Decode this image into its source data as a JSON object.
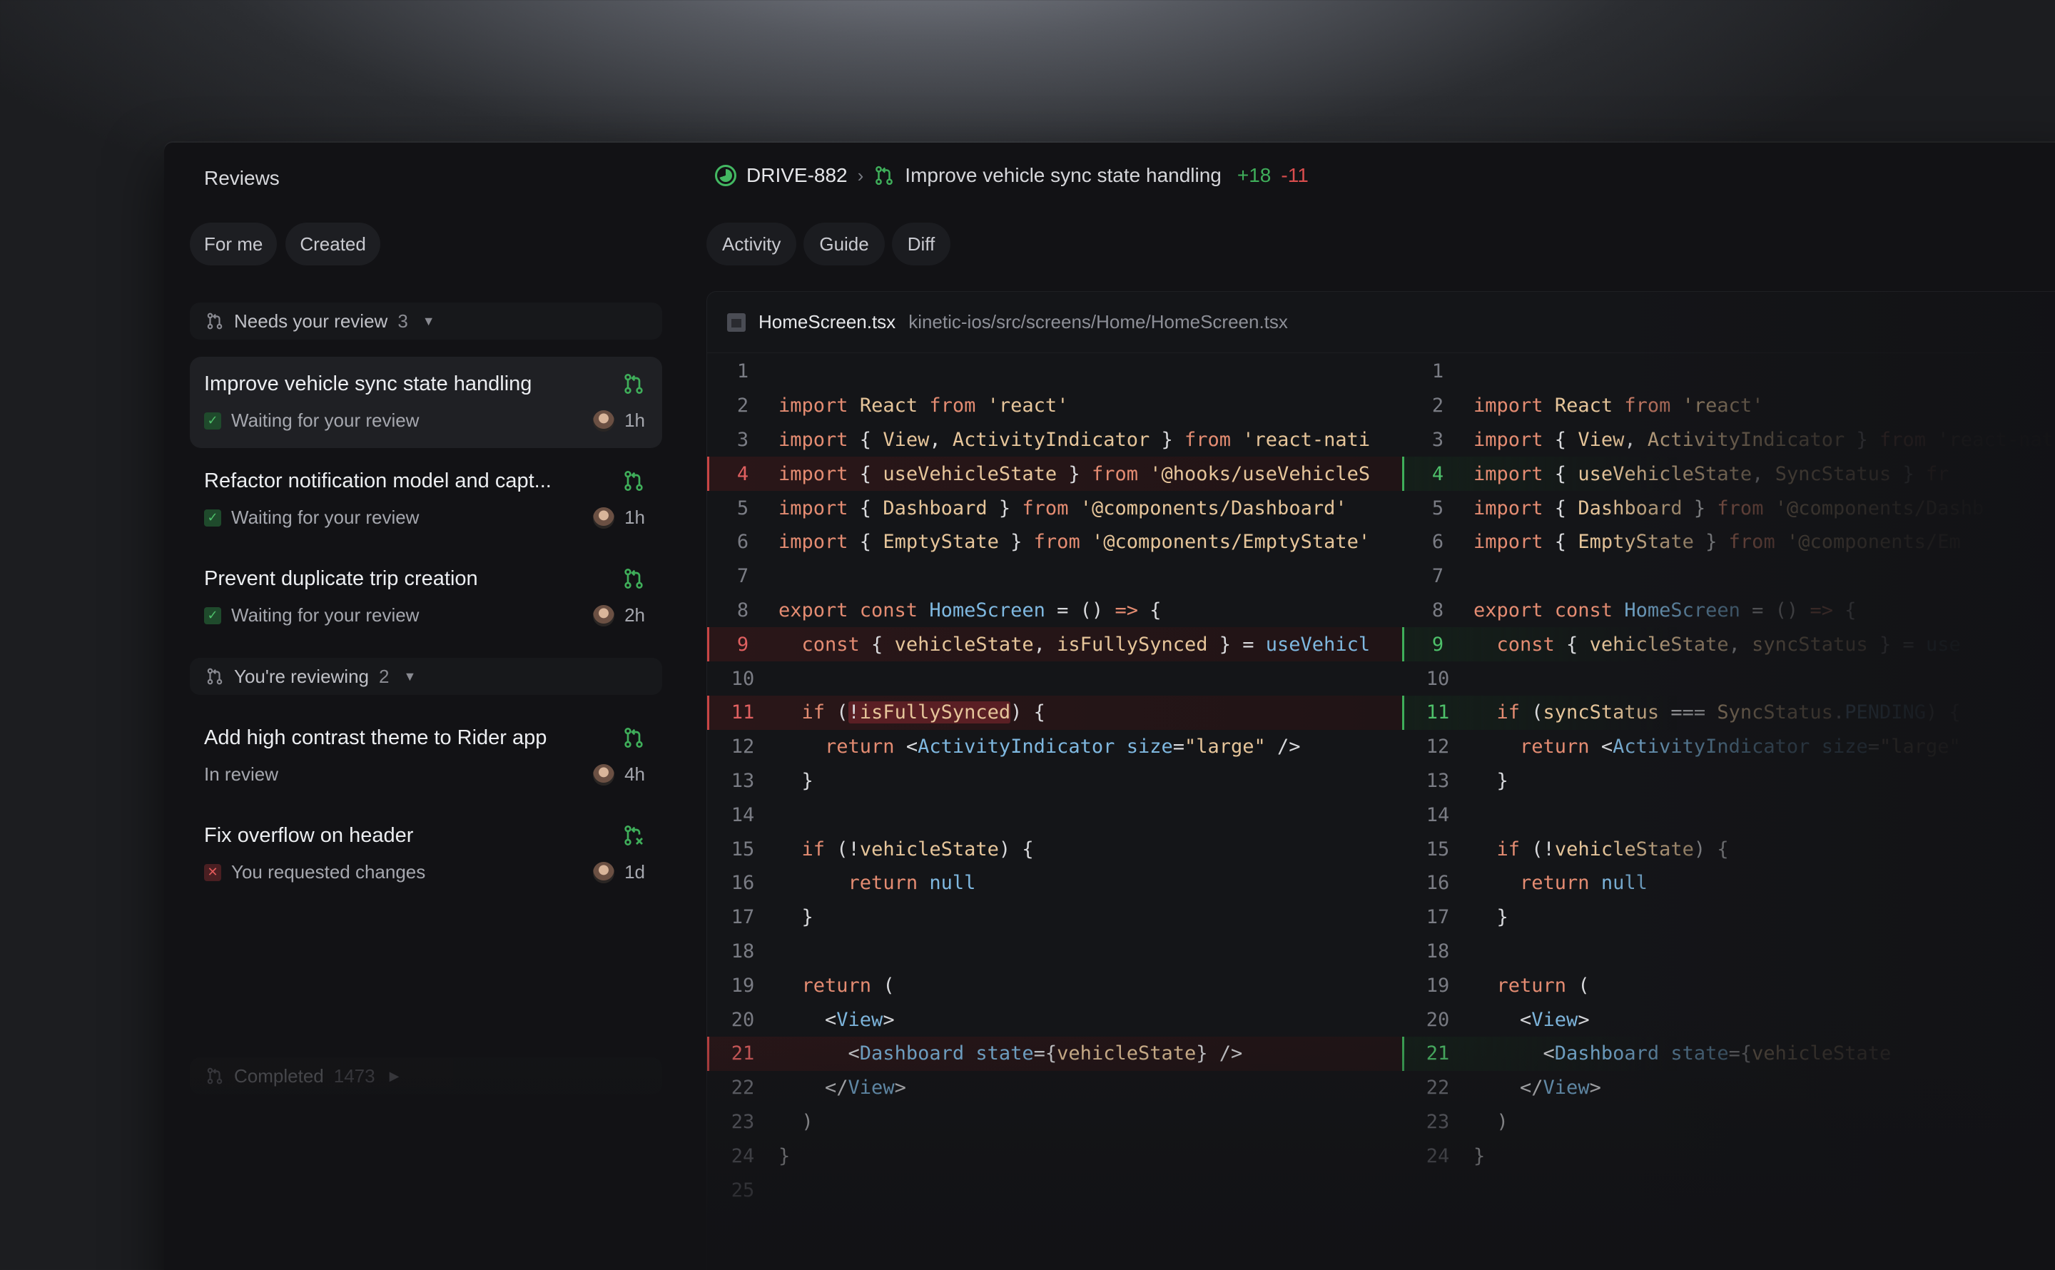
{
  "sidebar": {
    "title": "Reviews",
    "filters": [
      "For me",
      "Created"
    ],
    "groups": [
      {
        "label": "Needs your review",
        "count": "3"
      },
      {
        "label": "You're reviewing",
        "count": "2"
      },
      {
        "label": "Completed",
        "count": "1473"
      }
    ],
    "items": [
      {
        "title": "Improve vehicle sync state handling",
        "status": "Waiting for your review",
        "age": "1h"
      },
      {
        "title": "Refactor notification model and capt...",
        "status": "Waiting for your review",
        "age": "1h"
      },
      {
        "title": "Prevent duplicate trip creation",
        "status": "Waiting for your review",
        "age": "2h"
      },
      {
        "title": "Add high contrast theme to Rider app",
        "status": "In review",
        "age": "4h"
      },
      {
        "title": "Fix overflow on header",
        "status": "You requested changes",
        "age": "1d"
      }
    ]
  },
  "header": {
    "ticket": "DRIVE-882",
    "title": "Improve vehicle sync state handling",
    "additions": "+18",
    "deletions": "-11"
  },
  "tabs": [
    "Activity",
    "Guide",
    "Diff"
  ],
  "file": {
    "name": "HomeScreen.tsx",
    "path": "kinetic-ios/src/screens/Home/HomeScreen.tsx"
  },
  "colors": {
    "added": "#3fae5a",
    "removed": "#d94d4d",
    "keyword": "#e48c72",
    "string": "#e6c59a",
    "component": "#7fb8e0"
  }
}
